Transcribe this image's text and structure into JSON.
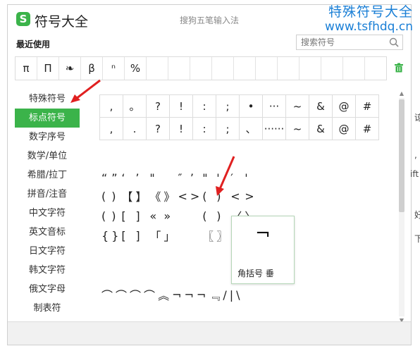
{
  "title": "符号大全",
  "ime_title": "搜狗五笔输入法",
  "watermark": {
    "line1": "特殊符号大全",
    "line2": "www.tsfhdq.cn"
  },
  "recent": {
    "label": "最近使用",
    "items": [
      "π",
      "Π",
      "❧",
      "β",
      "ⁿ",
      "%"
    ]
  },
  "search": {
    "placeholder": "搜索符号"
  },
  "sidebar": {
    "items": [
      "特殊符号",
      "标点符号",
      "数字序号",
      "数学/单位",
      "希腊/拉丁",
      "拼音/注音",
      "中文字符",
      "英文音标",
      "日文字符",
      "韩文字符",
      "俄文字母",
      "制表符"
    ],
    "active_index": 1
  },
  "grid_top": [
    [
      ",",
      "。",
      "?",
      "!",
      ":",
      ";",
      "•",
      "···",
      "~",
      "&",
      "@",
      "#"
    ],
    [
      ",",
      ".",
      "?",
      "!",
      ":",
      ";",
      "、",
      "······",
      "~",
      "&",
      "@",
      "#"
    ]
  ],
  "grid_mid": [
    [
      "“",
      "”",
      "‘",
      "’",
      "\"",
      "",
      "″",
      "’",
      "\"",
      "'",
      "′",
      "'"
    ],
    [
      "(",
      ")",
      "【",
      "】",
      "《",
      "》",
      "<",
      ">",
      "(",
      ")",
      "<",
      ">"
    ],
    [
      "(",
      ")",
      "[",
      "]",
      "«",
      "»",
      "",
      "",
      "(",
      ")",
      "〈",
      "〉"
    ],
    [
      "{",
      "}",
      "[",
      "]",
      "「",
      "」",
      "",
      "",
      "〖",
      "〗",
      "『",
      "』"
    ]
  ],
  "grid_bottom": [
    [
      "⌒",
      "⌒",
      "⌒",
      "⌒",
      "︽",
      "¬",
      "¬",
      "¬",
      "﹃",
      "/",
      "|",
      "\\"
    ]
  ],
  "preview": {
    "glyph": "¬",
    "name": "角括号  垂"
  },
  "edge_chars": [
    "谅",
    ",",
    "ift",
    "好",
    "下"
  ],
  "colors": {
    "accent": "#3bb34a",
    "watermark": "#1a7fd6",
    "arrow": "#e02020"
  },
  "icons": {
    "search": "search-icon",
    "trash": "trash-icon",
    "logo": "sogou-logo-icon"
  }
}
